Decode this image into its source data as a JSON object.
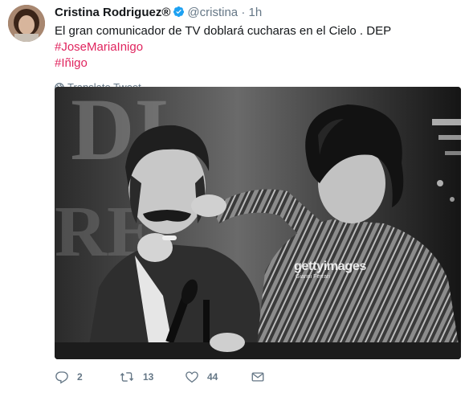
{
  "tweet": {
    "display_name": "Cristina Rodriguez®",
    "handle": "@cristina",
    "separator": "·",
    "time": "1h",
    "text_plain": "El gran comunicador de TV doblará cucharas en el Cielo . DEP ",
    "hashtag_1": "#JoseMariaInigo",
    "hashtag_2": "#Iñigo",
    "translate_label": "Translate Tweet",
    "image": {
      "watermark_brand": "gettyimages",
      "watermark_credit": "Gianni Ferrari"
    },
    "actions": {
      "reply_count": "2",
      "retweet_count": "13",
      "like_count": "44"
    }
  },
  "colors": {
    "hashtag": "#e0245e",
    "verified": "#1da1f2",
    "secondary_text": "#657786",
    "primary_text": "#14171a"
  },
  "icons": [
    "verified-badge-icon",
    "globe-icon",
    "reply-icon",
    "retweet-icon",
    "heart-icon",
    "envelope-icon"
  ]
}
